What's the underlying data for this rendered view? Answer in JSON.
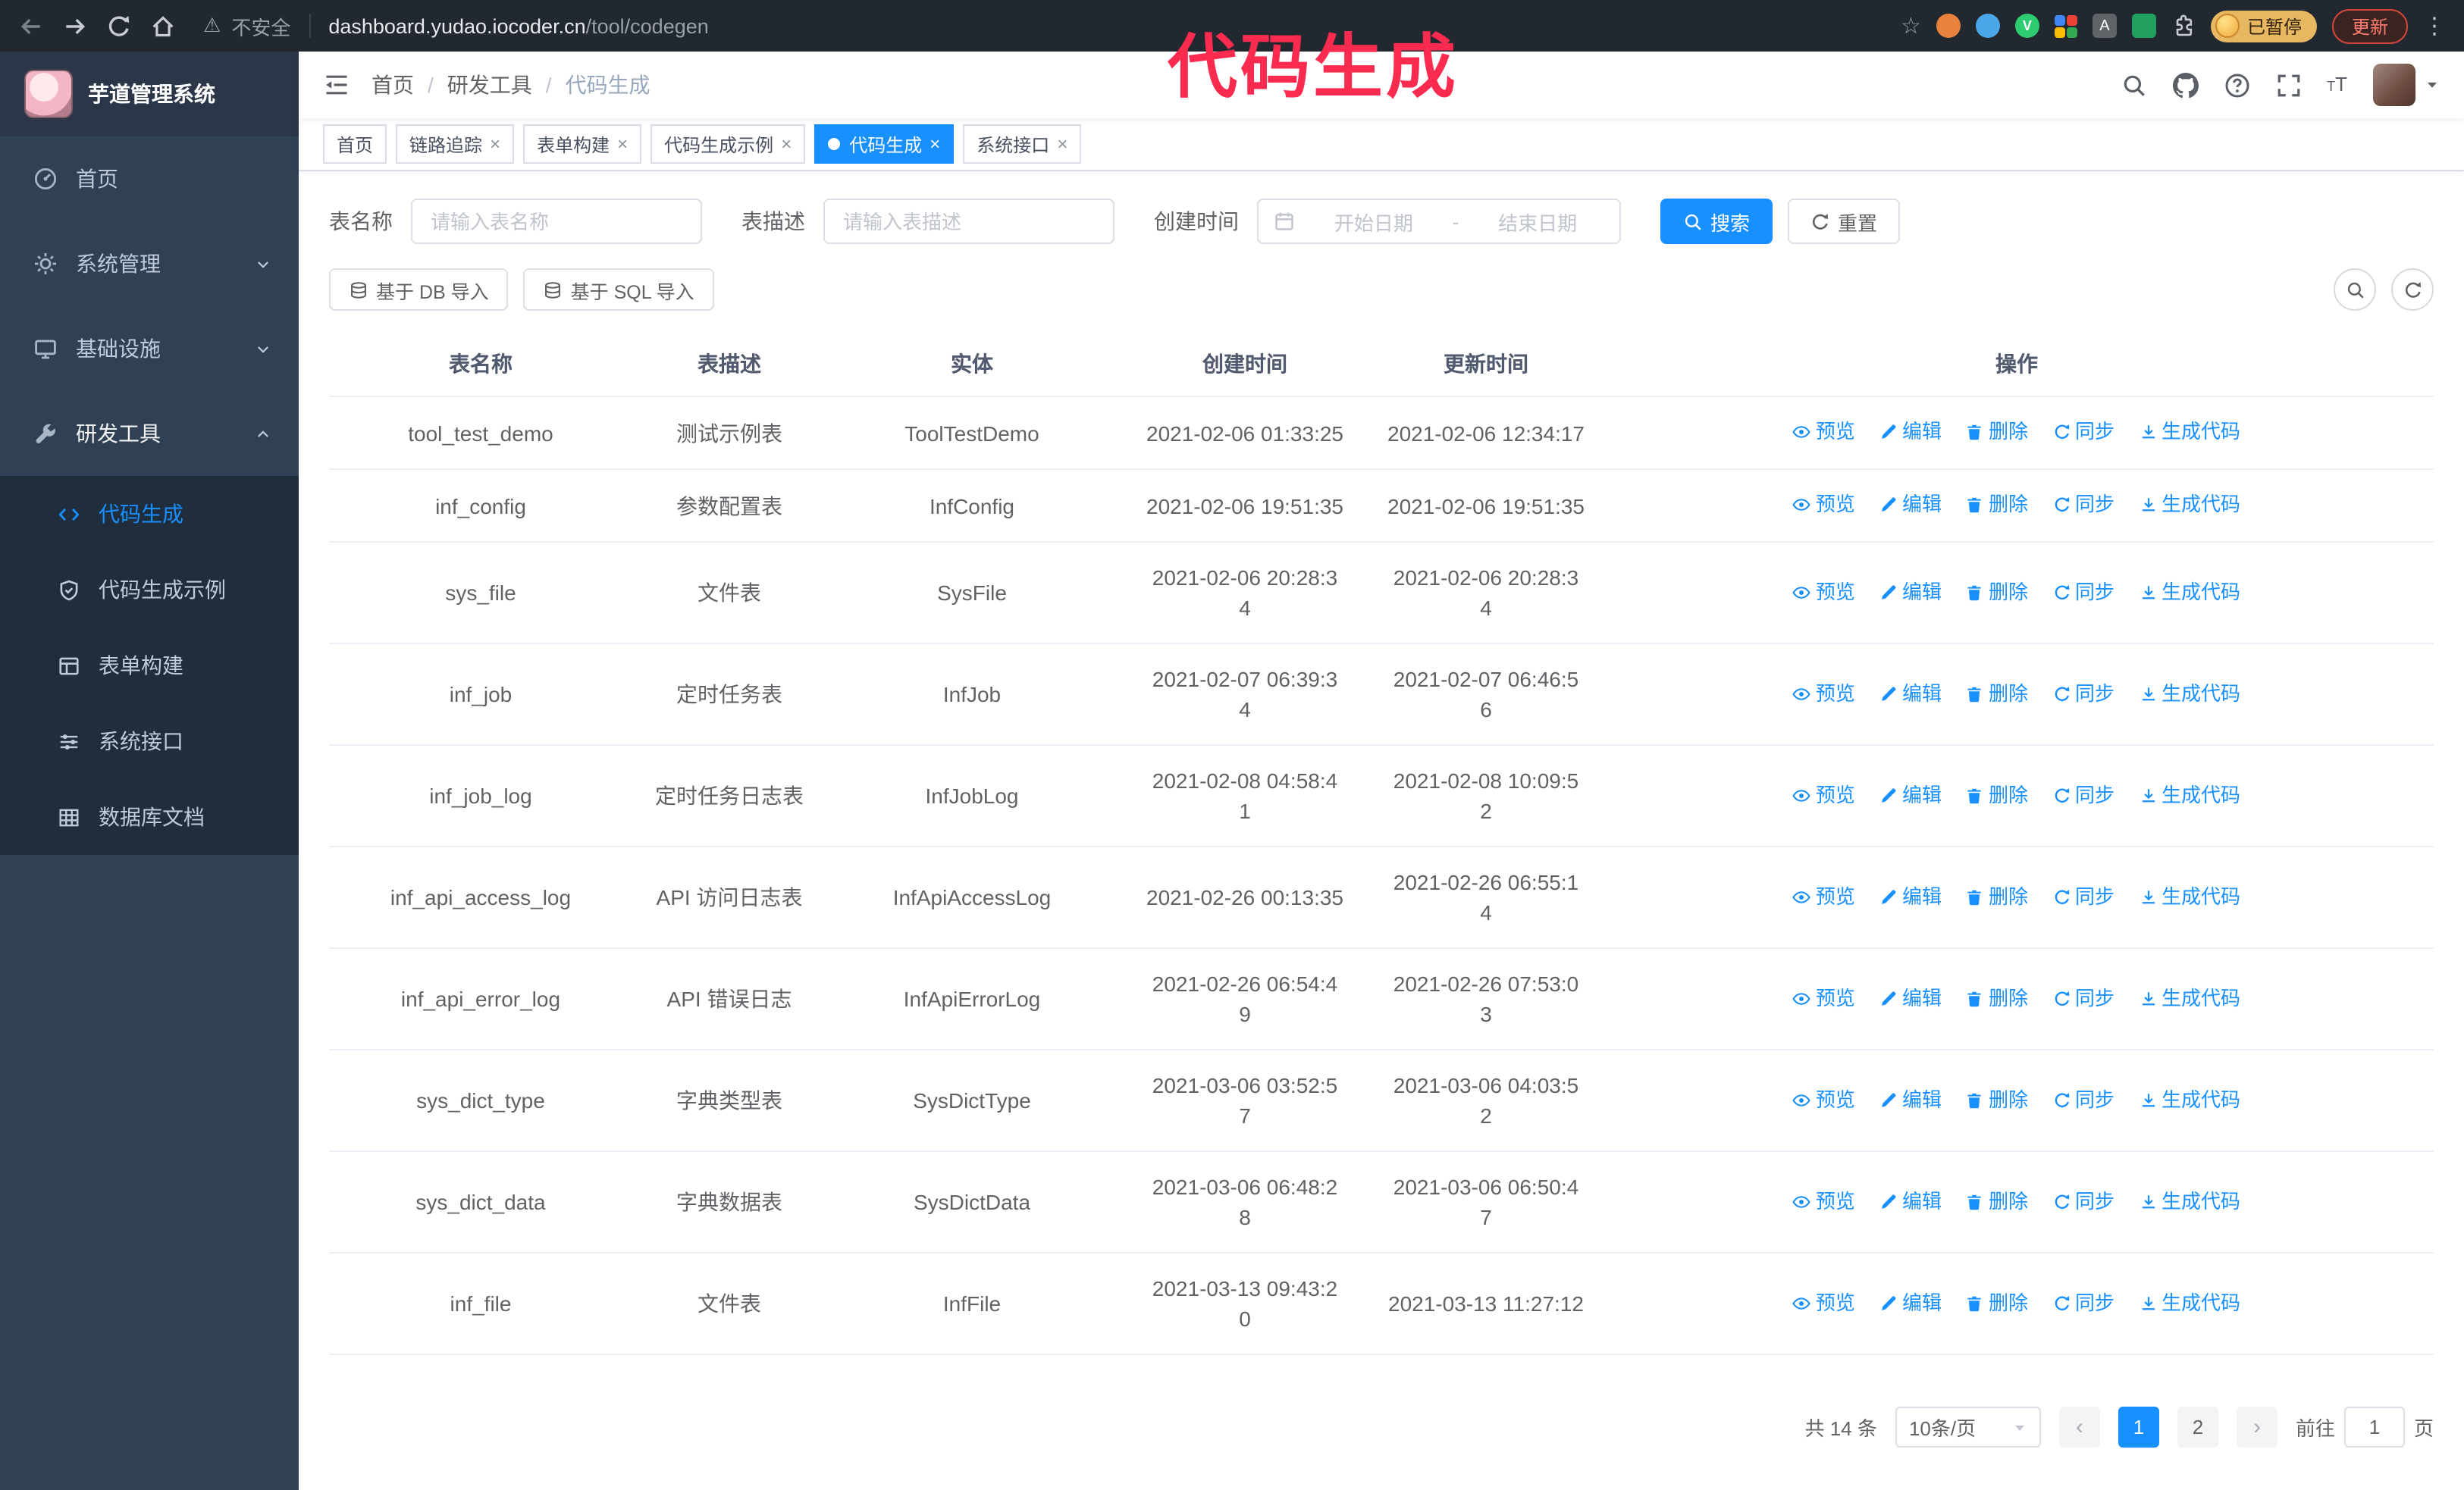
{
  "browser": {
    "security_label": "不安全",
    "url_host": "dashboard.yudao.iocoder.cn",
    "url_path": "/tool/codegen",
    "paused_badge": "已暂停",
    "update_button": "更新"
  },
  "annotation": {
    "text": "代码生成"
  },
  "sidebar": {
    "logo_title": "芋道管理系统",
    "items": [
      {
        "label": "首页"
      },
      {
        "label": "系统管理"
      },
      {
        "label": "基础设施"
      },
      {
        "label": "研发工具"
      }
    ],
    "submenu": [
      {
        "label": "代码生成"
      },
      {
        "label": "代码生成示例"
      },
      {
        "label": "表单构建"
      },
      {
        "label": "系统接口"
      },
      {
        "label": "数据库文档"
      }
    ]
  },
  "navbar": {
    "breadcrumb": [
      "首页",
      "研发工具",
      "代码生成"
    ]
  },
  "tabs": [
    {
      "label": "首页"
    },
    {
      "label": "链路追踪"
    },
    {
      "label": "表单构建"
    },
    {
      "label": "代码生成示例"
    },
    {
      "label": "代码生成"
    },
    {
      "label": "系统接口"
    }
  ],
  "filters": {
    "name_label": "表名称",
    "name_placeholder": "请输入表名称",
    "desc_label": "表描述",
    "desc_placeholder": "请输入表描述",
    "time_label": "创建时间",
    "start_placeholder": "开始日期",
    "range_separator": "-",
    "end_placeholder": "结束日期",
    "search_button": "搜索",
    "reset_button": "重置"
  },
  "toolbar": {
    "import_db": "基于 DB 导入",
    "import_sql": "基于 SQL 导入"
  },
  "table": {
    "headers": [
      "表名称",
      "表描述",
      "实体",
      "创建时间",
      "更新时间",
      "操作"
    ],
    "ops": {
      "preview": "预览",
      "edit": "编辑",
      "delete": "删除",
      "sync": "同步",
      "generate": "生成代码"
    },
    "rows": [
      {
        "name": "tool_test_demo",
        "desc": "测试示例表",
        "entity": "ToolTestDemo",
        "created": "2021-02-06 01:33:25",
        "updated": "2021-02-06 12:34:17"
      },
      {
        "name": "inf_config",
        "desc": "参数配置表",
        "entity": "InfConfig",
        "created": "2021-02-06 19:51:35",
        "updated": "2021-02-06 19:51:35"
      },
      {
        "name": "sys_file",
        "desc": "文件表",
        "entity": "SysFile",
        "created": "2021-02-06 20:28:3\n4",
        "updated": "2021-02-06 20:28:3\n4"
      },
      {
        "name": "inf_job",
        "desc": "定时任务表",
        "entity": "InfJob",
        "created": "2021-02-07 06:39:3\n4",
        "updated": "2021-02-07 06:46:5\n6"
      },
      {
        "name": "inf_job_log",
        "desc": "定时任务日志表",
        "entity": "InfJobLog",
        "created": "2021-02-08 04:58:4\n1",
        "updated": "2021-02-08 10:09:5\n2"
      },
      {
        "name": "inf_api_access_log",
        "desc": "API 访问日志表",
        "entity": "InfApiAccessLog",
        "created": "2021-02-26 00:13:35",
        "updated": "2021-02-26 06:55:1\n4"
      },
      {
        "name": "inf_api_error_log",
        "desc": "API 错误日志",
        "entity": "InfApiErrorLog",
        "created": "2021-02-26 06:54:4\n9",
        "updated": "2021-02-26 07:53:0\n3"
      },
      {
        "name": "sys_dict_type",
        "desc": "字典类型表",
        "entity": "SysDictType",
        "created": "2021-03-06 03:52:5\n7",
        "updated": "2021-03-06 04:03:5\n2"
      },
      {
        "name": "sys_dict_data",
        "desc": "字典数据表",
        "entity": "SysDictData",
        "created": "2021-03-06 06:48:2\n8",
        "updated": "2021-03-06 06:50:4\n7"
      },
      {
        "name": "inf_file",
        "desc": "文件表",
        "entity": "InfFile",
        "created": "2021-03-13 09:43:2\n0",
        "updated": "2021-03-13 11:27:12"
      }
    ]
  },
  "pagination": {
    "total": "共 14 条",
    "page_size": "10条/页",
    "page1": "1",
    "page2": "2",
    "goto_label": "前往",
    "goto_value": "1",
    "goto_unit": "页"
  }
}
